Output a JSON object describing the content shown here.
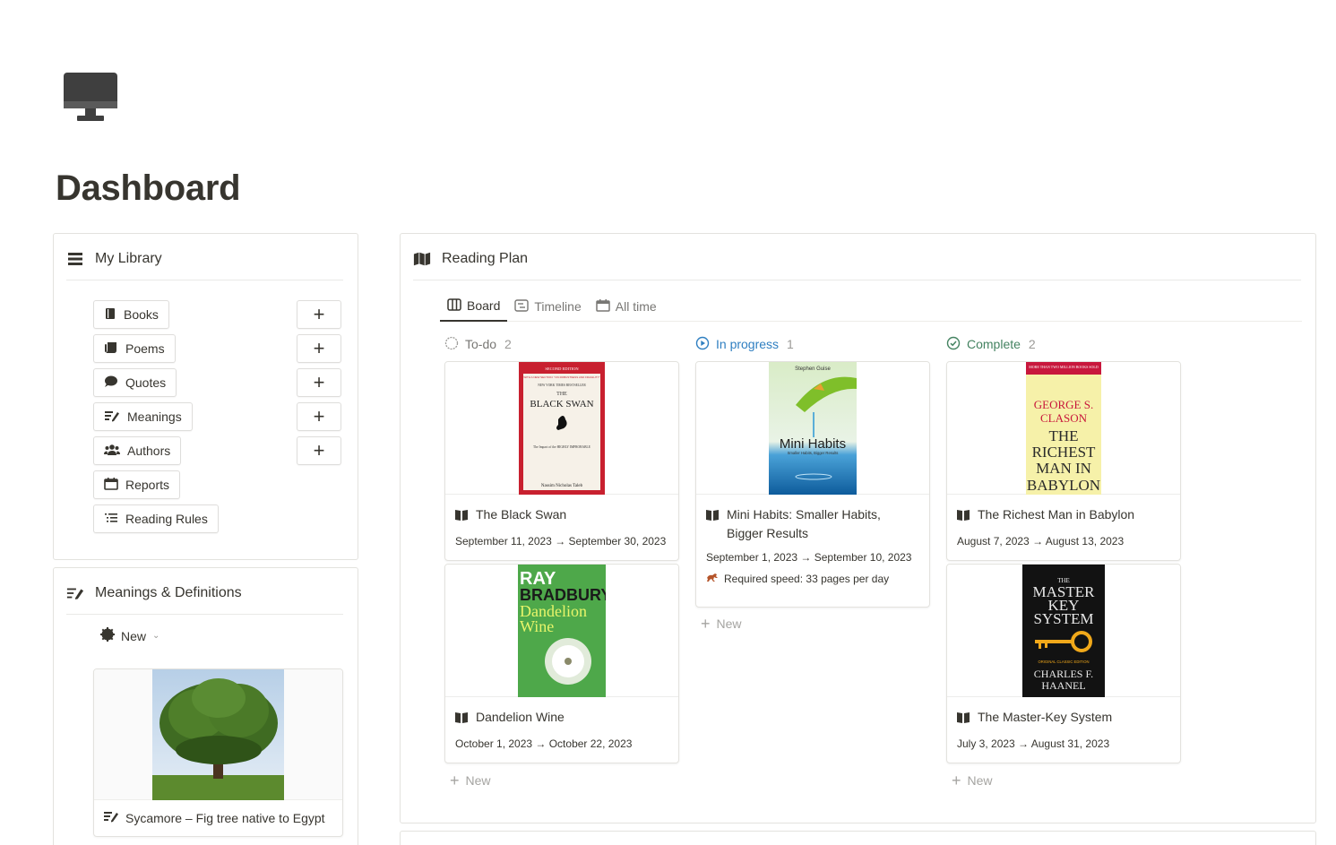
{
  "page": {
    "title": "Dashboard",
    "icon": "desktop-computer-icon"
  },
  "library": {
    "title": "My Library",
    "icon": "list-icon",
    "items": [
      {
        "label": "Books",
        "icon": "book-icon",
        "has_add": true
      },
      {
        "label": "Poems",
        "icon": "scroll-icon",
        "has_add": true
      },
      {
        "label": "Quotes",
        "icon": "speech-bubble-icon",
        "has_add": true
      },
      {
        "label": "Meanings",
        "icon": "edit-list-icon",
        "has_add": true
      },
      {
        "label": "Authors",
        "icon": "people-icon",
        "has_add": true
      },
      {
        "label": "Reports",
        "icon": "calendar-icon",
        "has_add": false
      },
      {
        "label": "Reading Rules",
        "icon": "checklist-icon",
        "has_add": false
      }
    ],
    "add_symbol": "+"
  },
  "meanings": {
    "title": "Meanings & Definitions",
    "view_label": "New",
    "card": {
      "title": "Sycamore – Fig tree native to Egypt"
    }
  },
  "plan": {
    "title": "Reading Plan",
    "tabs": [
      {
        "label": "Board",
        "active": true
      },
      {
        "label": "Timeline",
        "active": false
      },
      {
        "label": "All time",
        "active": false
      }
    ],
    "columns": [
      {
        "label": "To-do",
        "count": "2",
        "color": "#787774",
        "cards": [
          {
            "title": "The Black Swan",
            "dates": "September 11, 2023 → September 30, 2023"
          },
          {
            "title": "Dandelion Wine",
            "dates": "October 1, 2023 → October 22, 2023"
          }
        ],
        "new_label": "New"
      },
      {
        "label": "In progress",
        "count": "1",
        "color": "#2f7fc1",
        "cards": [
          {
            "title": "Mini Habits: Smaller Habits, Bigger Results",
            "dates": "September 1, 2023 → September 10, 2023",
            "speed": "Required speed: 33 pages per day"
          }
        ],
        "new_label": "New"
      },
      {
        "label": "Complete",
        "count": "2",
        "color": "#448361",
        "cards": [
          {
            "title": "The Richest Man in Babylon",
            "dates": "August 7, 2023 → August 13, 2023"
          },
          {
            "title": "The Master-Key System",
            "dates": "July 3, 2023 → August 31, 2023"
          }
        ],
        "new_label": "New"
      }
    ]
  },
  "covers": {
    "black_swan": {
      "edition": "SECOND EDITION",
      "banner": "WITH A NEW SECTION: \"ON ROBUSTNESS AND FRAGILITY\"",
      "line": "NEW YORK TIMES BESTSELLER",
      "the": "THE",
      "title": "BLACK SWAN",
      "sub": "The Impact of the HIGHLY IMPROBABLE",
      "author": "Nassim Nicholas Taleb"
    },
    "dandelion": {
      "author1": "RAY",
      "author2": "BRADBURY",
      "title1": "Dandelion",
      "title2": "Wine"
    },
    "mini_habits": {
      "author": "Stephen Guise",
      "title": "Mini Habits",
      "sub": "Smaller Habits, Bigger Results"
    },
    "babylon": {
      "top": "MORE THAN TWO MILLION BOOKS SOLD",
      "author1": "GEORGE S.",
      "author2": "CLASON",
      "t1": "THE",
      "t2": "RICHEST",
      "t3": "MAN IN",
      "t4": "BABYLON"
    },
    "master_key": {
      "t1": "THE",
      "t2": "MASTER",
      "t3": "KEY",
      "t4": "SYSTEM",
      "edition": "ORIGINAL CLASSIC EDITION",
      "a1": "CHARLES F.",
      "a2": "HAANEL"
    }
  }
}
